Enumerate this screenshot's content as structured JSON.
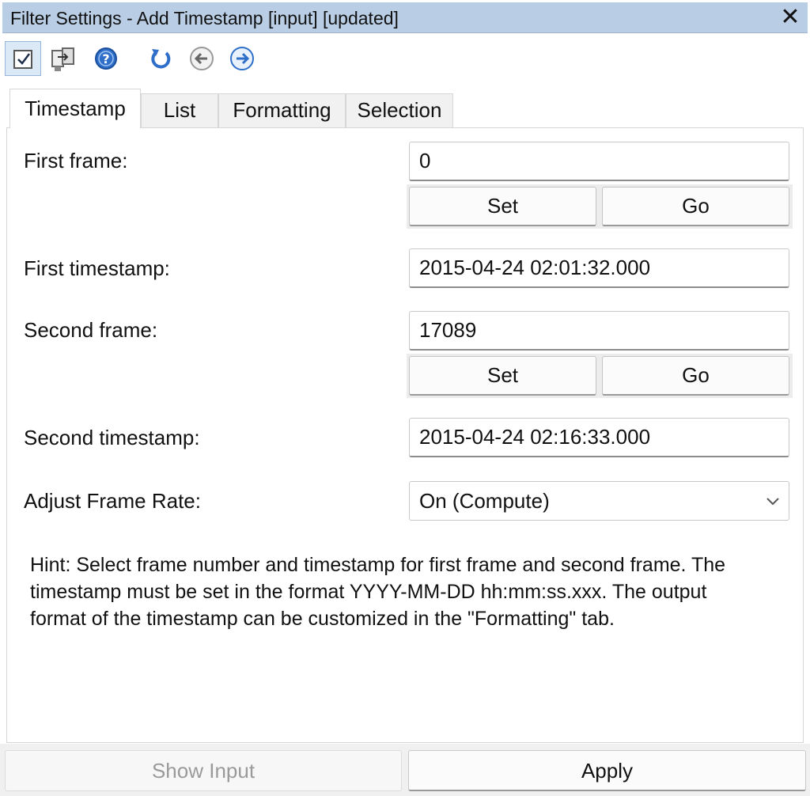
{
  "window": {
    "title": "Filter Settings - Add Timestamp [input] [updated]",
    "close_glyph": "✕"
  },
  "toolbar": {
    "buttons": [
      {
        "icon": "checkbox-icon",
        "active": true
      },
      {
        "icon": "copy-settings-icon",
        "active": false
      },
      {
        "icon": "help-icon",
        "active": false
      },
      {
        "icon": "reset-icon",
        "active": false
      },
      {
        "icon": "back-icon",
        "active": false
      },
      {
        "icon": "forward-icon",
        "active": false
      }
    ]
  },
  "tabs": [
    {
      "label": "Timestamp",
      "selected": true
    },
    {
      "label": "List",
      "selected": false
    },
    {
      "label": "Formatting",
      "selected": false
    },
    {
      "label": "Selection",
      "selected": false
    }
  ],
  "form": {
    "first_frame": {
      "label": "First frame:",
      "value": "0",
      "set_label": "Set",
      "go_label": "Go"
    },
    "first_timestamp": {
      "label": "First timestamp:",
      "value": "2015-04-24 02:01:32.000"
    },
    "second_frame": {
      "label": "Second frame:",
      "value": "17089",
      "set_label": "Set",
      "go_label": "Go"
    },
    "second_timestamp": {
      "label": "Second timestamp:",
      "value": "2015-04-24 02:16:33.000"
    },
    "adjust_frame_rate": {
      "label": "Adjust Frame Rate:",
      "value": "On (Compute)"
    }
  },
  "hint": {
    "lines": [
      "Hint: Select frame number and timestamp for first frame and second frame. The",
      "timestamp must be set in the format YYYY-MM-DD hh:mm:ss.xxx. The output",
      "format of the timestamp can be customized in the \"Formatting\" tab."
    ]
  },
  "footer": {
    "show_input_label": "Show Input",
    "apply_label": "Apply"
  },
  "colors": {
    "titlebar": "#b9cde5",
    "icon_blue": "#2f6fc9",
    "tab_inactive": "#f1f1f1"
  }
}
